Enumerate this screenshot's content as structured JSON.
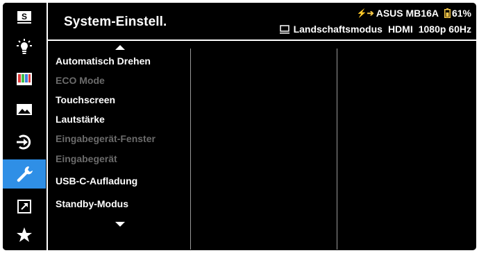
{
  "header": {
    "title": "System-Einstell.",
    "model": "ASUS MB16A",
    "battery": "61%",
    "mode": "Landschaftsmodus",
    "input": "HDMI",
    "resolution": "1080p 60Hz"
  },
  "sidebar": {
    "items": [
      {
        "icon": "s-splendid-icon",
        "active": false
      },
      {
        "icon": "brightness-icon",
        "active": false
      },
      {
        "icon": "color-bars-icon",
        "active": false
      },
      {
        "icon": "image-icon",
        "active": false
      },
      {
        "icon": "input-select-icon",
        "active": false
      },
      {
        "icon": "wrench-icon",
        "active": true
      },
      {
        "icon": "shortcut-arrow-icon",
        "active": false
      },
      {
        "icon": "star-icon",
        "active": false
      }
    ]
  },
  "menu": {
    "items": [
      {
        "label": "Automatisch Drehen",
        "enabled": true
      },
      {
        "label": "ECO Mode",
        "enabled": false
      },
      {
        "label": "Touchscreen",
        "enabled": true
      },
      {
        "label": "Lautstärke",
        "enabled": true
      },
      {
        "label": "Eingabegerät-Fenster",
        "enabled": false
      },
      {
        "label": "Eingabegerät",
        "enabled": false
      },
      {
        "label": "USB-C-Aufladung",
        "enabled": true
      },
      {
        "label": "Standby-Modus",
        "enabled": true
      }
    ]
  },
  "colors": {
    "background": "#000000",
    "accent": "#2f8fe6",
    "text": "#ffffff",
    "disabled_text": "#6b6b6b",
    "battery": "#f7c948"
  }
}
